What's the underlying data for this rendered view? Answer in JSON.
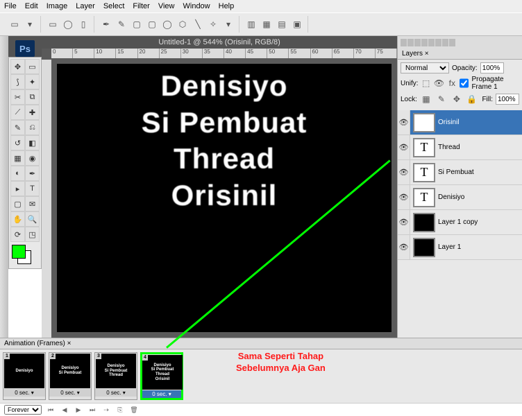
{
  "menu": [
    "File",
    "Edit",
    "Image",
    "Layer",
    "Select",
    "Filter",
    "View",
    "Window",
    "Help"
  ],
  "doc": {
    "title": "Untitled-1 @ 544% (Orisinil, RGB/8)"
  },
  "canvas_lines": [
    "Denisiyo",
    "Si Pembuat",
    "Thread",
    "Orisinil"
  ],
  "ruler_marks": [
    "0",
    "5",
    "10",
    "15",
    "20",
    "25",
    "30",
    "35",
    "40",
    "45",
    "50",
    "55",
    "60",
    "65",
    "70",
    "75"
  ],
  "layers_panel": {
    "tab": "Layers ×",
    "blend": "Normal",
    "opacity_label": "Opacity:",
    "opacity_val": "100%",
    "unify": "Unify:",
    "propagate": "Propagate Frame 1",
    "lock": "Lock:",
    "fill_label": "Fill:",
    "fill_val": "100%",
    "items": [
      {
        "name": "Orisinil",
        "type": "T",
        "sel": true
      },
      {
        "name": "Thread",
        "type": "T"
      },
      {
        "name": "Si Pembuat",
        "type": "T"
      },
      {
        "name": "Denisiyo",
        "type": "T"
      },
      {
        "name": "Layer 1 copy",
        "type": "B"
      },
      {
        "name": "Layer 1",
        "type": "B"
      }
    ]
  },
  "animation": {
    "tab": "Animation (Frames) ×",
    "loop": "Forever",
    "frames": [
      {
        "n": "1",
        "lines": [
          "Denisiyo"
        ],
        "delay": "0 sec."
      },
      {
        "n": "2",
        "lines": [
          "Denisiyo",
          "Si Pembuat"
        ],
        "delay": "0 sec."
      },
      {
        "n": "3",
        "lines": [
          "Denisiyo",
          "Si Pembuat",
          "Thread"
        ],
        "delay": "0 sec."
      },
      {
        "n": "4",
        "lines": [
          "Denisiyo",
          "Si Pembuat",
          "Thread",
          "Orisinil"
        ],
        "delay": "0 sec.",
        "on": true
      }
    ]
  },
  "annotation": {
    "line1": "Sama Seperti Tahap",
    "line2": "Sebelumnya Aja Gan"
  },
  "colors": {
    "swatch": "#00ff00"
  }
}
